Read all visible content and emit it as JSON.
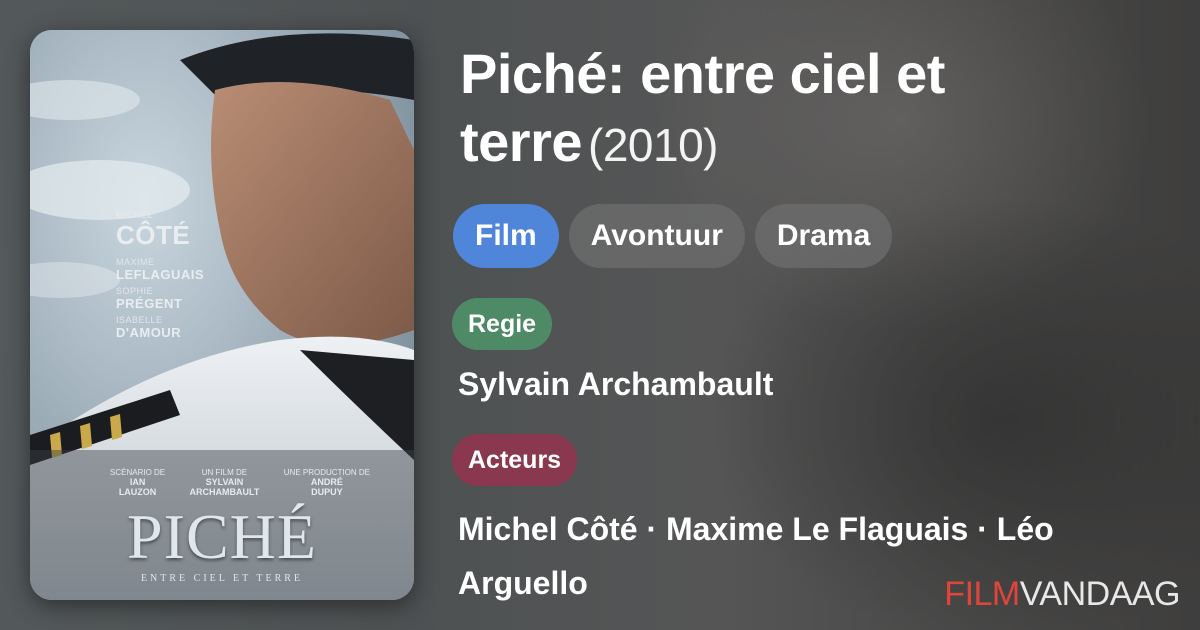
{
  "movie": {
    "title": "Piché: entre ciel et terre",
    "year": "(2010)",
    "genres": [
      "Film",
      "Avontuur",
      "Drama"
    ]
  },
  "poster": {
    "cast_top": {
      "first_small": "MICHEL",
      "first_big": "CÔTÉ",
      "second_small": "MAXIME",
      "second_mid": "LEFLAGUAIS",
      "third_small": "SOPHIE",
      "third_mid": "PRÉGENT",
      "fourth_small": "ISABELLE",
      "fourth_mid": "D'AMOUR"
    },
    "credits": [
      {
        "small": "SCÉNARIO DE",
        "first": "IAN",
        "last": "LAUZON"
      },
      {
        "small": "UN FILM DE",
        "first": "SYLVAIN",
        "last": "ARCHAMBAULT"
      },
      {
        "small": "UNE PRODUCTION DE",
        "first": "ANDRÉ",
        "last": "DUPUY"
      }
    ],
    "title": "PICHÉ",
    "subtitle": "ENTRE CIEL ET TERRE"
  },
  "regie": {
    "label": "Regie",
    "value": "Sylvain Archambault"
  },
  "acteurs": {
    "label": "Acteurs",
    "value": "Michel Côté · Maxime Le Flaguais · Léo Arguello"
  },
  "brand": {
    "part1": "FILM",
    "part2": "VANDAAG"
  },
  "colors": {
    "film_pill": "#4f86d9",
    "regie_label": "#4f8a66",
    "acteurs_label": "#8a3850",
    "brand_red": "#e0453b"
  }
}
